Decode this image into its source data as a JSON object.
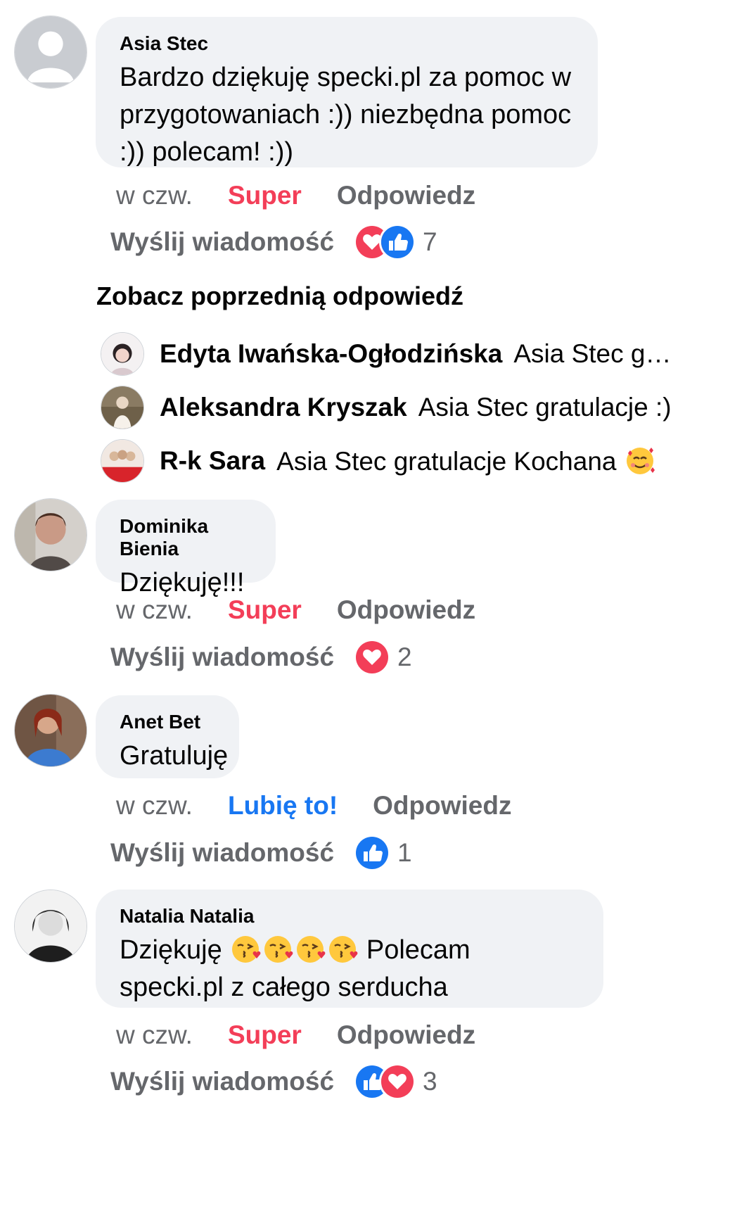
{
  "comments": [
    {
      "author": "Asia Stec",
      "text": "Bardzo dziękuję specki.pl za pomoc w przygotowaniach :)) niezbędna pomoc :)) polecam! :))",
      "time": "w czw.",
      "reaction_label": "Super",
      "reply_label": "Odpowiedz",
      "send_label": "Wyślij wiadomość",
      "reaction_count": "7",
      "reaction_icons": [
        "heart-icon",
        "like-icon"
      ]
    },
    {
      "author": "Dominika Bienia",
      "text": "Dziękuję!!!",
      "time": "w czw.",
      "reaction_label": "Super",
      "reply_label": "Odpowiedz",
      "send_label": "Wyślij wiadomość",
      "reaction_count": "2",
      "reaction_icons": [
        "heart-icon"
      ]
    },
    {
      "author": "Anet Bet",
      "text": "Gratuluję",
      "time": "w czw.",
      "reaction_label": "Lubię to!",
      "reply_label": "Odpowiedz",
      "send_label": "Wyślij wiadomość",
      "reaction_count": "1",
      "reaction_icons": [
        "like-icon"
      ]
    },
    {
      "author": "Natalia Natalia",
      "text_before": "Dziękuję",
      "text_after": "Polecam specki.pl z całego serducha",
      "emojis": [
        "kissing-face-icon",
        "kissing-face-icon",
        "kissing-face-icon",
        "kissing-face-icon"
      ],
      "time": "w czw.",
      "reaction_label": "Super",
      "reply_label": "Odpowiedz",
      "send_label": "Wyślij wiadomość",
      "reaction_count": "3",
      "reaction_icons": [
        "like-icon",
        "heart-icon"
      ]
    }
  ],
  "previous_replies_label": "Zobacz poprzednią odpowiedź",
  "replies": [
    {
      "name": "Edyta Iwańska-Ogłodzińska",
      "text": "Asia Stec gratulacje"
    },
    {
      "name": "Aleksandra Kryszak",
      "text": "Asia Stec gratulacje :)"
    },
    {
      "name": "R-k Sara",
      "text": "Asia Stec gratulacje Kochana",
      "emoji": "smiling-face-with-hearts-icon"
    }
  ],
  "colors": {
    "super": "#f33e58",
    "like": "#1877f2",
    "meta": "#65676b",
    "bubble": "#f0f2f5"
  }
}
